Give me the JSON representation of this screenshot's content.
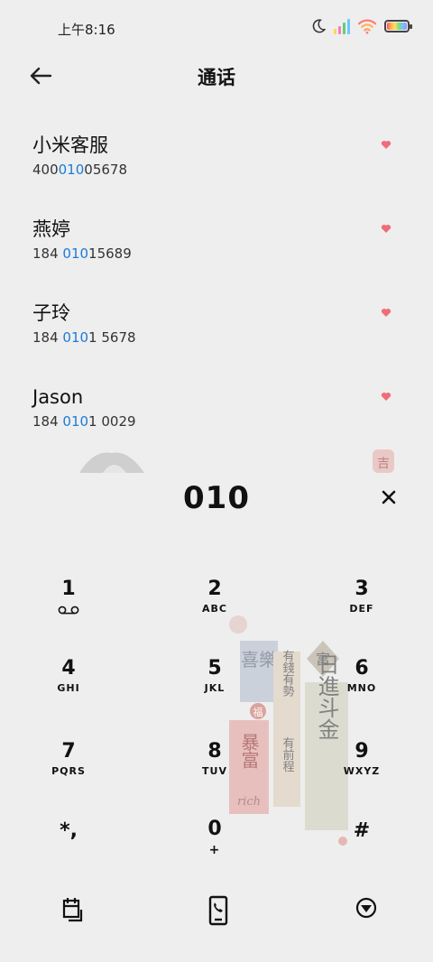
{
  "status_bar": {
    "time": "上午8:16",
    "icons": [
      "moon-icon",
      "signal-icon",
      "wifi-icon",
      "battery-icon"
    ],
    "signal_colors": [
      "#ffd84d",
      "#ff7ab6",
      "#5fd07a",
      "#6ec6ff"
    ]
  },
  "header": {
    "title": "通话",
    "back_icon": "back-arrow-icon"
  },
  "contacts": [
    {
      "name": "小米客服",
      "number_pre": "400",
      "number_hl": "010",
      "number_post": "05678"
    },
    {
      "name": "燕婷",
      "number_pre": "184 ",
      "number_hl": "010",
      "number_post": "15689"
    },
    {
      "name": "子玲",
      "number_pre": "184 ",
      "number_hl": "010",
      "number_post": "1 5678"
    },
    {
      "name": "Jason",
      "number_pre": "184 ",
      "number_hl": "010",
      "number_post": "1 0029"
    }
  ],
  "dialer": {
    "input": "010",
    "clear_icon": "close-icon"
  },
  "keypad": [
    {
      "digit": "1",
      "letters": "",
      "icon": "voicemail-icon"
    },
    {
      "digit": "2",
      "letters": "ABC"
    },
    {
      "digit": "3",
      "letters": "DEF"
    },
    {
      "digit": "4",
      "letters": "GHI"
    },
    {
      "digit": "5",
      "letters": "JKL"
    },
    {
      "digit": "6",
      "letters": "MNO"
    },
    {
      "digit": "7",
      "letters": "PQRS"
    },
    {
      "digit": "8",
      "letters": "TUV"
    },
    {
      "digit": "9",
      "letters": "WXYZ"
    },
    {
      "digit": "*,",
      "letters": ""
    },
    {
      "digit": "0",
      "letters": "+"
    },
    {
      "digit": "#",
      "letters": ""
    }
  ],
  "art_text": [
    "喜樂",
    "有錢有勢",
    "富",
    "日進斗金",
    "有前程",
    "暴富",
    "rich",
    "福"
  ],
  "bottom_bar": [
    "calendar-icon",
    "phone-dial-icon",
    "collapse-keypad-icon"
  ],
  "colors": {
    "background": "#eeeeee",
    "highlight": "#1a7cd9",
    "heart": "#f06c7a"
  }
}
